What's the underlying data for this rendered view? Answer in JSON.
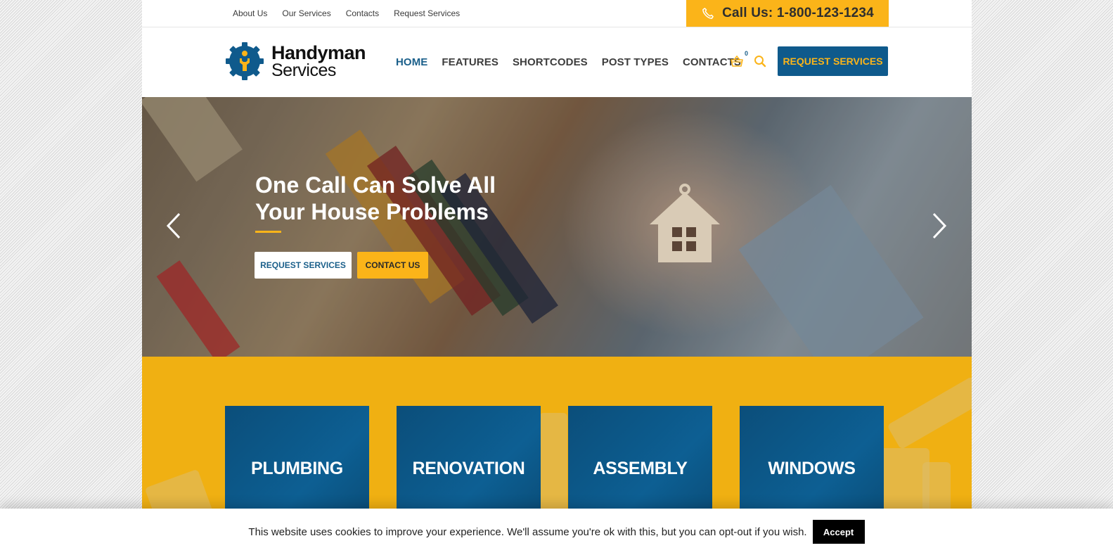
{
  "topbar": {
    "links": [
      "About Us",
      "Our Services",
      "Contacts",
      "Request Services"
    ],
    "call": {
      "icon": "phone-icon",
      "label": "Call Us: 1-800-123-1234"
    }
  },
  "header": {
    "logo": {
      "line1": "Handyman",
      "line2": "Services"
    },
    "nav": [
      {
        "label": "HOME",
        "active": true
      },
      {
        "label": "FEATURES",
        "active": false
      },
      {
        "label": "SHORTCODES",
        "active": false
      },
      {
        "label": "POST TYPES",
        "active": false
      },
      {
        "label": "CONTACTS",
        "active": false
      }
    ],
    "cart_count": "0",
    "cta_label": "REQUEST SERVICES"
  },
  "hero": {
    "title": "One Call Can Solve All Your House Problems",
    "primary_button": "REQUEST SERVICES",
    "secondary_button": "CONTACT US",
    "prev_icon": "chevron-left-icon",
    "next_icon": "chevron-right-icon"
  },
  "services": [
    {
      "label": "PLUMBING"
    },
    {
      "label": "RENOVATION"
    },
    {
      "label": "ASSEMBLY"
    },
    {
      "label": "WINDOWS"
    }
  ],
  "cookie": {
    "message": "This website uses cookies to improve your experience. We'll assume you're ok with this, but you can opt-out if you wish.",
    "accept_label": "Accept"
  },
  "colors": {
    "accent_yellow": "#fbb419",
    "brand_blue": "#0f5a8c",
    "band_yellow": "#f0b012"
  }
}
